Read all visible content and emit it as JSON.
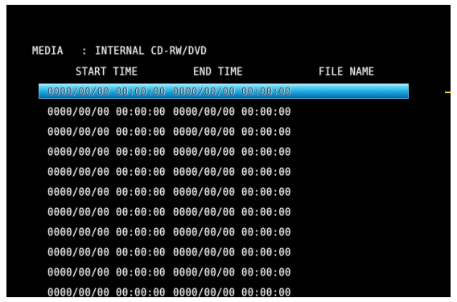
{
  "media": {
    "label": "MEDIA",
    "separator": ":",
    "value": "INTERNAL CD-RW/DVD"
  },
  "table": {
    "columns": {
      "start_time": "START TIME",
      "end_time": "END TIME",
      "file_name": "FILE NAME"
    },
    "selected_index": 0,
    "rows": [
      {
        "start": "0000/00/00 00:00:00",
        "end": "0000/00/00 00:00:00",
        "file": ""
      },
      {
        "start": "0000/00/00 00:00:00",
        "end": "0000/00/00 00:00:00",
        "file": ""
      },
      {
        "start": "0000/00/00 00:00:00",
        "end": "0000/00/00 00:00:00",
        "file": ""
      },
      {
        "start": "0000/00/00 00:00:00",
        "end": "0000/00/00 00:00:00",
        "file": ""
      },
      {
        "start": "0000/00/00 00:00:00",
        "end": "0000/00/00 00:00:00",
        "file": ""
      },
      {
        "start": "0000/00/00 00:00:00",
        "end": "0000/00/00 00:00:00",
        "file": ""
      },
      {
        "start": "0000/00/00 00:00:00",
        "end": "0000/00/00 00:00:00",
        "file": ""
      },
      {
        "start": "0000/00/00 00:00:00",
        "end": "0000/00/00 00:00:00",
        "file": ""
      },
      {
        "start": "0000/00/00 00:00:00",
        "end": "0000/00/00 00:00:00",
        "file": ""
      },
      {
        "start": "0000/00/00 00:00:00",
        "end": "0000/00/00 00:00:00",
        "file": ""
      },
      {
        "start": "0000/00/00 00:00:00",
        "end": "0000/00/00 00:00:00",
        "file": ""
      }
    ]
  },
  "colors": {
    "background": "#000000",
    "text": "#e6e6e6",
    "highlight": "#1aa6dc",
    "marker": "#ffd700"
  }
}
